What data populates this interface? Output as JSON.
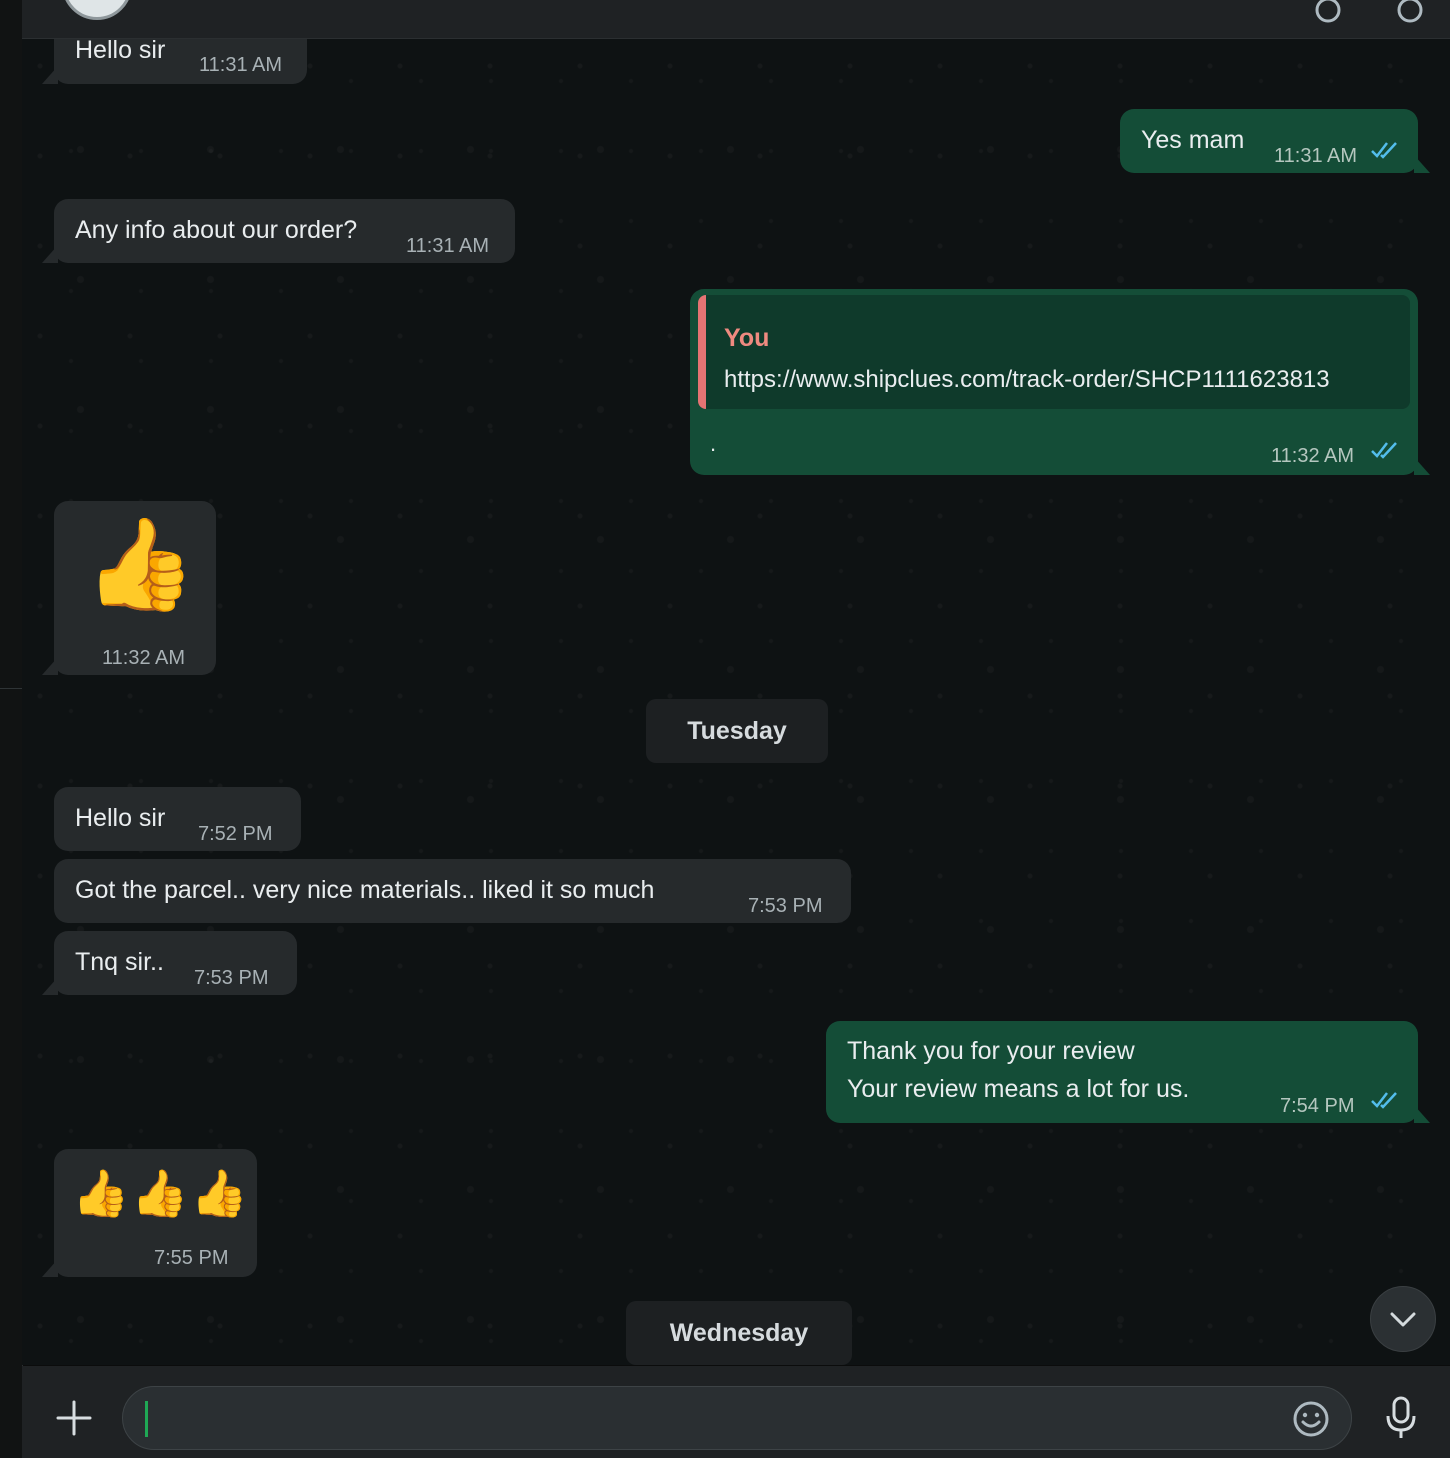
{
  "messages": {
    "m1": {
      "text": "Hello sir",
      "time": "11:31 AM"
    },
    "m2": {
      "text": "Yes mam",
      "time": "11:31 AM"
    },
    "m3": {
      "text": "Any info about our order?",
      "time": "11:31 AM"
    },
    "m4": {
      "quote_author": "You",
      "quote_url": "https://www.shipclues.com/track-order/SHCP1111623813",
      "text": ".",
      "time": "11:32 AM"
    },
    "m5": {
      "emoji": "👍",
      "time": "11:32 AM"
    },
    "m6": {
      "text": "Hello sir",
      "time": "7:52 PM"
    },
    "m7": {
      "text": "Got the parcel.. very nice materials.. liked it so much",
      "time": "7:53 PM"
    },
    "m8": {
      "text": "Tnq sir..",
      "time": "7:53 PM"
    },
    "m9": {
      "line1": "Thank you for your review",
      "line2": "Your review means a lot for us.",
      "time": "7:54 PM"
    },
    "m10": {
      "emoji": "👍👍👍",
      "time": "7:55 PM"
    }
  },
  "days": {
    "d1": "Tuesday",
    "d2": "Wednesday"
  },
  "composer": {
    "placeholder": ""
  },
  "icons": {
    "read": "double-check-icon",
    "scroll": "chevron-down-icon",
    "attach": "plus-icon",
    "emoji": "emoji-icon",
    "mic": "mic-icon"
  },
  "colors": {
    "incoming": "#262a2c",
    "outgoing": "#144d37",
    "read_tick": "#53bdeb",
    "quote_bar": "#e57373"
  }
}
